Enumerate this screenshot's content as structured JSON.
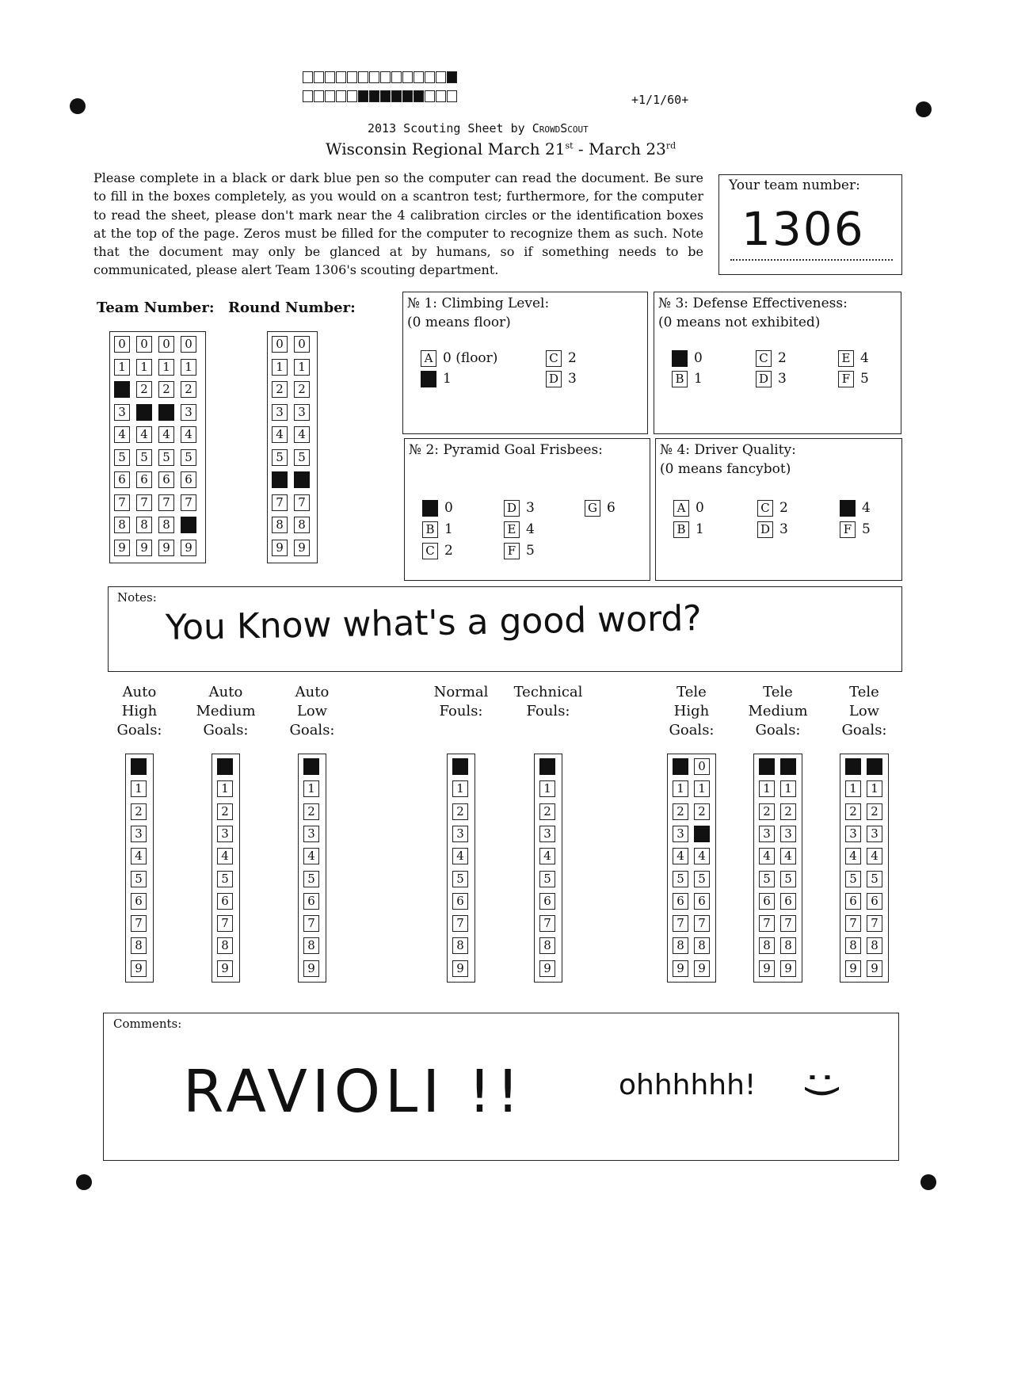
{
  "header": {
    "code": "+1/1/60+",
    "title_prefix": "2013 Scouting Sheet by",
    "title_brand": "CrowdScout",
    "event_a": "Wisconsin Regional March 21",
    "event_sup1": "st",
    "event_b": " - March 23",
    "event_sup2": "rd"
  },
  "instructions": "Please complete in a black or dark blue pen so the computer can read the document. Be sure to fill in the boxes completely, as you would on a scantron test; furthermore, for the computer to read the sheet, please don't mark near the 4 calibration circles or the identification boxes at the top of the page. Zeros must be filled for the computer to recognize them as such. Note that the document may only be glanced at by humans, so if something needs to be communicated, please alert Team 1306's scouting department.",
  "your_team": {
    "label": "Your team number:",
    "value": "1306"
  },
  "labels": {
    "team_number": "Team Number:",
    "round_number": "Round Number:"
  },
  "team_number_grid": {
    "digits": 4,
    "selected": [
      2,
      3,
      3,
      8
    ]
  },
  "round_number_grid": {
    "digits": 2,
    "selected": [
      6,
      6
    ]
  },
  "questions": [
    {
      "title": "№ 1: Climbing Level:",
      "sub": "(0 means floor)",
      "options": [
        {
          "key": "A",
          "text": "0 (floor)",
          "sel": false
        },
        {
          "key": "B",
          "text": "1",
          "sel": true
        },
        {
          "key": "C",
          "text": "2",
          "sel": false
        },
        {
          "key": "D",
          "text": "3",
          "sel": false
        }
      ]
    },
    {
      "title": "№ 2: Pyramid Goal Frisbees:",
      "sub": "",
      "options": [
        {
          "key": "A",
          "text": "0",
          "sel": true
        },
        {
          "key": "B",
          "text": "1",
          "sel": false
        },
        {
          "key": "C",
          "text": "2",
          "sel": false
        },
        {
          "key": "D",
          "text": "3",
          "sel": false
        },
        {
          "key": "E",
          "text": "4",
          "sel": false
        },
        {
          "key": "F",
          "text": "5",
          "sel": false
        },
        {
          "key": "G",
          "text": "6",
          "sel": false
        }
      ]
    },
    {
      "title": "№ 3: Defense Effectiveness:",
      "sub": "(0 means not exhibited)",
      "options": [
        {
          "key": "A",
          "text": "0",
          "sel": true
        },
        {
          "key": "B",
          "text": "1",
          "sel": false
        },
        {
          "key": "C",
          "text": "2",
          "sel": false
        },
        {
          "key": "D",
          "text": "3",
          "sel": false
        },
        {
          "key": "E",
          "text": "4",
          "sel": false
        },
        {
          "key": "F",
          "text": "5",
          "sel": false
        }
      ]
    },
    {
      "title": "№ 4: Driver Quality:",
      "sub": "(0 means fancybot)",
      "options": [
        {
          "key": "A",
          "text": "0",
          "sel": false
        },
        {
          "key": "B",
          "text": "1",
          "sel": false
        },
        {
          "key": "C",
          "text": "2",
          "sel": false
        },
        {
          "key": "D",
          "text": "3",
          "sel": false
        },
        {
          "key": "E",
          "text": "4",
          "sel": true
        },
        {
          "key": "F",
          "text": "5",
          "sel": false
        }
      ]
    }
  ],
  "notes": {
    "label": "Notes:",
    "text": "You Know what's a good word?"
  },
  "score_columns": [
    {
      "label": "Auto\nHigh\nGoals:",
      "digits": 1,
      "selected": [
        0
      ]
    },
    {
      "label": "Auto\nMedium\nGoals:",
      "digits": 1,
      "selected": [
        0
      ]
    },
    {
      "label": "Auto\nLow\nGoals:",
      "digits": 1,
      "selected": [
        0
      ]
    },
    {
      "label": "Normal\nFouls:",
      "digits": 1,
      "selected": [
        0
      ]
    },
    {
      "label": "Technical\nFouls:",
      "digits": 1,
      "selected": [
        0
      ]
    },
    {
      "label": "Tele\nHigh\nGoals:",
      "digits": 2,
      "selected": [
        0,
        3
      ]
    },
    {
      "label": "Tele\nMedium\nGoals:",
      "digits": 2,
      "selected": [
        0,
        0
      ]
    },
    {
      "label": "Tele\nLow\nGoals:",
      "digits": 2,
      "selected": [
        0,
        0
      ]
    }
  ],
  "comments": {
    "label": "Comments:",
    "text_main": "RAVIOLI !!",
    "text_small": "ohhhhhh!",
    "smiley": ":)"
  }
}
